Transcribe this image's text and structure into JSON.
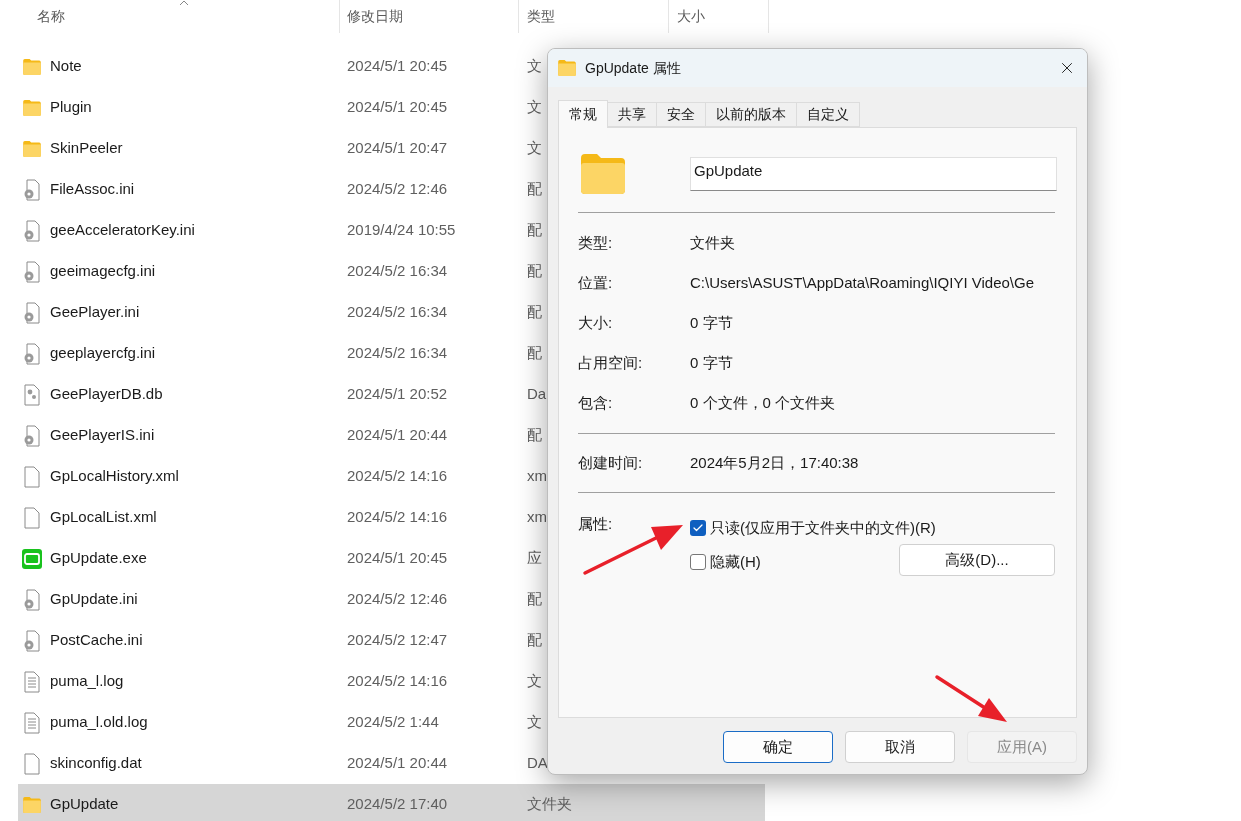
{
  "explorer": {
    "columns": [
      {
        "label": "名称",
        "sorted": true
      },
      {
        "label": "修改日期",
        "sorted": false
      },
      {
        "label": "类型",
        "sorted": false
      },
      {
        "label": "大小",
        "sorted": false
      }
    ],
    "files": [
      {
        "name": "Note",
        "modified": "2024/5/1 20:45",
        "type": "文",
        "kind": "folder",
        "selected": false
      },
      {
        "name": "Plugin",
        "modified": "2024/5/1 20:45",
        "type": "文",
        "kind": "folder",
        "selected": false
      },
      {
        "name": "SkinPeeler",
        "modified": "2024/5/1 20:47",
        "type": "文",
        "kind": "folder",
        "selected": false
      },
      {
        "name": "FileAssoc.ini",
        "modified": "2024/5/2 12:46",
        "type": "配",
        "kind": "ini",
        "selected": false
      },
      {
        "name": "geeAcceleratorKey.ini",
        "modified": "2019/4/24 10:55",
        "type": "配",
        "kind": "ini",
        "selected": false
      },
      {
        "name": "geeimagecfg.ini",
        "modified": "2024/5/2 16:34",
        "type": "配",
        "kind": "ini",
        "selected": false
      },
      {
        "name": "GeePlayer.ini",
        "modified": "2024/5/2 16:34",
        "type": "配",
        "kind": "ini",
        "selected": false
      },
      {
        "name": "geeplayercfg.ini",
        "modified": "2024/5/2 16:34",
        "type": "配",
        "kind": "ini",
        "selected": false
      },
      {
        "name": "GeePlayerDB.db",
        "modified": "2024/5/1 20:52",
        "type": "Da",
        "kind": "db",
        "selected": false
      },
      {
        "name": "GeePlayerIS.ini",
        "modified": "2024/5/1 20:44",
        "type": "配",
        "kind": "ini",
        "selected": false
      },
      {
        "name": "GpLocalHistory.xml",
        "modified": "2024/5/2 14:16",
        "type": "xm",
        "kind": "blank",
        "selected": false
      },
      {
        "name": "GpLocalList.xml",
        "modified": "2024/5/2 14:16",
        "type": "xm",
        "kind": "blank",
        "selected": false
      },
      {
        "name": "GpUpdate.exe",
        "modified": "2024/5/1 20:45",
        "type": "应",
        "kind": "app",
        "selected": false
      },
      {
        "name": "GpUpdate.ini",
        "modified": "2024/5/2 12:46",
        "type": "配",
        "kind": "ini",
        "selected": false
      },
      {
        "name": "PostCache.ini",
        "modified": "2024/5/2 12:47",
        "type": "配",
        "kind": "ini",
        "selected": false
      },
      {
        "name": "puma_l.log",
        "modified": "2024/5/2 14:16",
        "type": "文",
        "kind": "text",
        "selected": false
      },
      {
        "name": "puma_l.old.log",
        "modified": "2024/5/2 1:44",
        "type": "文",
        "kind": "text",
        "selected": false
      },
      {
        "name": "skinconfig.dat",
        "modified": "2024/5/1 20:44",
        "type": "DA",
        "kind": "blank",
        "selected": false
      },
      {
        "name": "GpUpdate",
        "modified": "2024/5/2 17:40",
        "type": "文件夹",
        "kind": "folder",
        "selected": true
      }
    ]
  },
  "dialog": {
    "title": "GpUpdate 属性",
    "tabs": [
      {
        "label": "常规",
        "selected": true
      },
      {
        "label": "共享",
        "selected": false
      },
      {
        "label": "安全",
        "selected": false
      },
      {
        "label": "以前的版本",
        "selected": false
      },
      {
        "label": "自定义",
        "selected": false
      }
    ],
    "name_value": "GpUpdate",
    "details": [
      {
        "label": "类型:",
        "value": "文件夹"
      },
      {
        "label": "位置:",
        "value": "C:\\Users\\ASUST\\AppData\\Roaming\\IQIYI Video\\Ge"
      },
      {
        "label": "大小:",
        "value": "0 字节"
      },
      {
        "label": "占用空间:",
        "value": "0 字节"
      },
      {
        "label": "包含:",
        "value": "0 个文件，0 个文件夹"
      }
    ],
    "created": {
      "label": "创建时间:",
      "value": "2024年5月2日，17:40:38"
    },
    "attributes": {
      "label": "属性:",
      "options": [
        {
          "label": "只读(仅应用于文件夹中的文件)(R)",
          "checked": true
        },
        {
          "label": "隐藏(H)",
          "checked": false
        }
      ],
      "advanced_button": "高级(D)..."
    },
    "buttons": [
      {
        "label": "确定",
        "kind": "default",
        "disabled": false
      },
      {
        "label": "取消",
        "kind": "normal",
        "disabled": false
      },
      {
        "label": "应用(A)",
        "kind": "normal",
        "disabled": true
      }
    ]
  }
}
